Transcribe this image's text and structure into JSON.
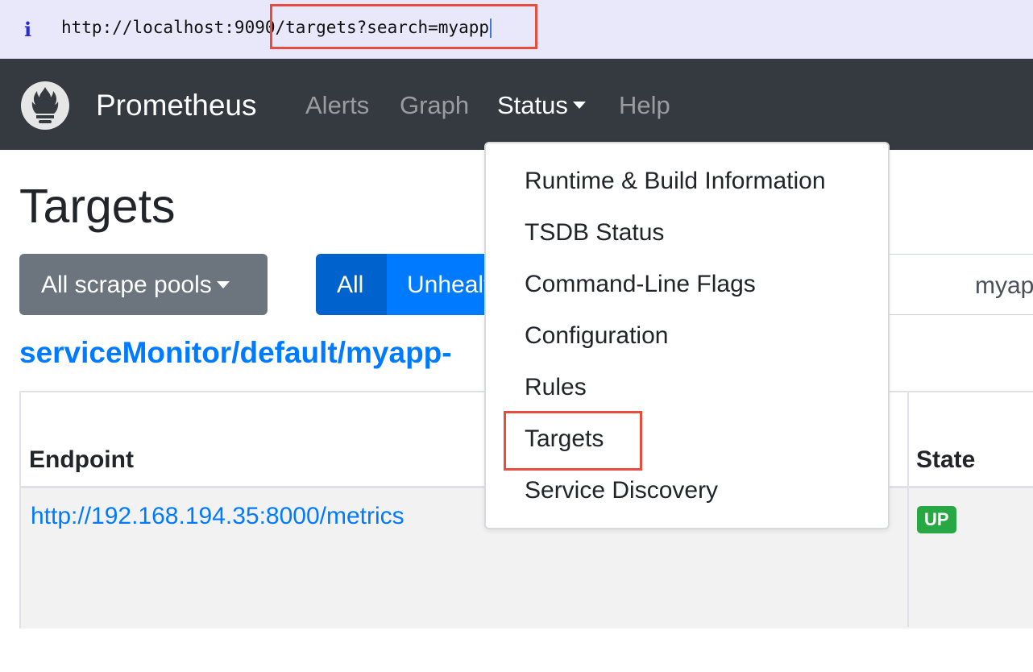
{
  "browser": {
    "info_icon": "i",
    "url": "http://localhost:9090/targets?search=myapp"
  },
  "navbar": {
    "brand": "Prometheus",
    "links": [
      "Alerts",
      "Graph",
      "Status",
      "Help"
    ],
    "active": "Status"
  },
  "status_menu": {
    "items": [
      "Runtime & Build Information",
      "TSDB Status",
      "Command-Line Flags",
      "Configuration",
      "Rules",
      "Targets",
      "Service Discovery"
    ],
    "highlighted": "Targets"
  },
  "page": {
    "title": "Targets",
    "pools_button": "All scrape pools",
    "filter_all": "All",
    "filter_unhealthy": "Unhealthy",
    "search_value": "myapp",
    "pool_name": "serviceMonitor/default/myapp-",
    "table": {
      "headers": {
        "endpoint": "Endpoint",
        "state": "State"
      },
      "rows": [
        {
          "endpoint": "http://192.168.194.35:8000/metrics",
          "state": "UP"
        }
      ]
    }
  },
  "colors": {
    "navbar": "#343a40",
    "primary": "#007bff",
    "primary_active": "#0062cc",
    "secondary": "#6c757d",
    "success": "#28a745",
    "annotation": "#e74c3c"
  },
  "icons": [
    "info-icon",
    "prometheus-logo-icon",
    "caret-down-icon"
  ]
}
